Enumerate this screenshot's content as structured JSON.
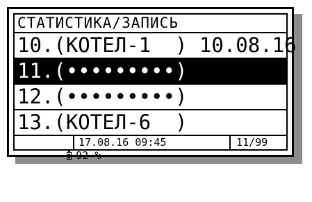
{
  "screen": {
    "title": "СТАТИСТИКА/ЗАПИСЬ",
    "records": [
      {
        "label": "10.(КОТЕЛ-1  ) 10.08.16",
        "selected": false
      },
      {
        "label": "11.(•••••••••)",
        "selected": true
      },
      {
        "label": "12.(•••••••••)",
        "selected": false
      },
      {
        "label": "13.(КОТЕЛ-6  )",
        "selected": false
      }
    ],
    "status": {
      "battery_icon": "battery-icon",
      "battery": "92 %",
      "datetime": "17.08.16 09:45",
      "counter": "11/99"
    }
  }
}
